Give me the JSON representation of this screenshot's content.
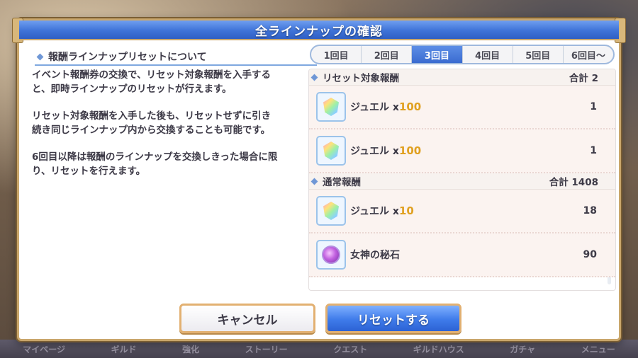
{
  "dialog": {
    "title": "全ラインナップの確認",
    "left_heading": "報酬ラインナップリセットについて",
    "paragraphs": [
      "イベント報酬券の交換で、リセット対象報酬を入手すると、即時ラインナップのリセットが行えます。",
      "リセット対象報酬を入手した後も、リセットせずに引き続き同じラインナップ内から交換することも可能です。",
      "6回目以降は報酬のラインナップを交換しきった場合に限り、リセットを行えます。"
    ]
  },
  "tabs": [
    "1回目",
    "2回目",
    "3回目",
    "4回目",
    "5回目",
    "6回目〜"
  ],
  "active_tab": "3回目",
  "sections": [
    {
      "title": "リセット対象報酬",
      "total": "合計 2",
      "items": [
        {
          "icon": "jewel-icon",
          "name": "ジュエル",
          "mult": "x",
          "amount": "100",
          "count": "1"
        },
        {
          "icon": "jewel-icon",
          "name": "ジュエル",
          "mult": "x",
          "amount": "100",
          "count": "1"
        }
      ]
    },
    {
      "title": "通常報酬",
      "total": "合計 1408",
      "items": [
        {
          "icon": "jewel-icon",
          "name": "ジュエル",
          "mult": "x",
          "amount": "10",
          "count": "18"
        },
        {
          "icon": "goddess-stone-icon",
          "name": "女神の秘石",
          "mult": "",
          "amount": "",
          "count": "90"
        }
      ]
    }
  ],
  "buttons": {
    "cancel": "キャンセル",
    "reset": "リセットする"
  },
  "bottom_nav": [
    "マイページ",
    "ギルド",
    "強化",
    "ストーリー",
    "クエスト",
    "ギルドハウス",
    "ガチャ",
    "メニュー"
  ],
  "colors": {
    "title_bar": "#3f73d8",
    "gold_border": "#c9a66b",
    "amount_orange": "#e0a020",
    "reset_button": "#3f7bea"
  }
}
